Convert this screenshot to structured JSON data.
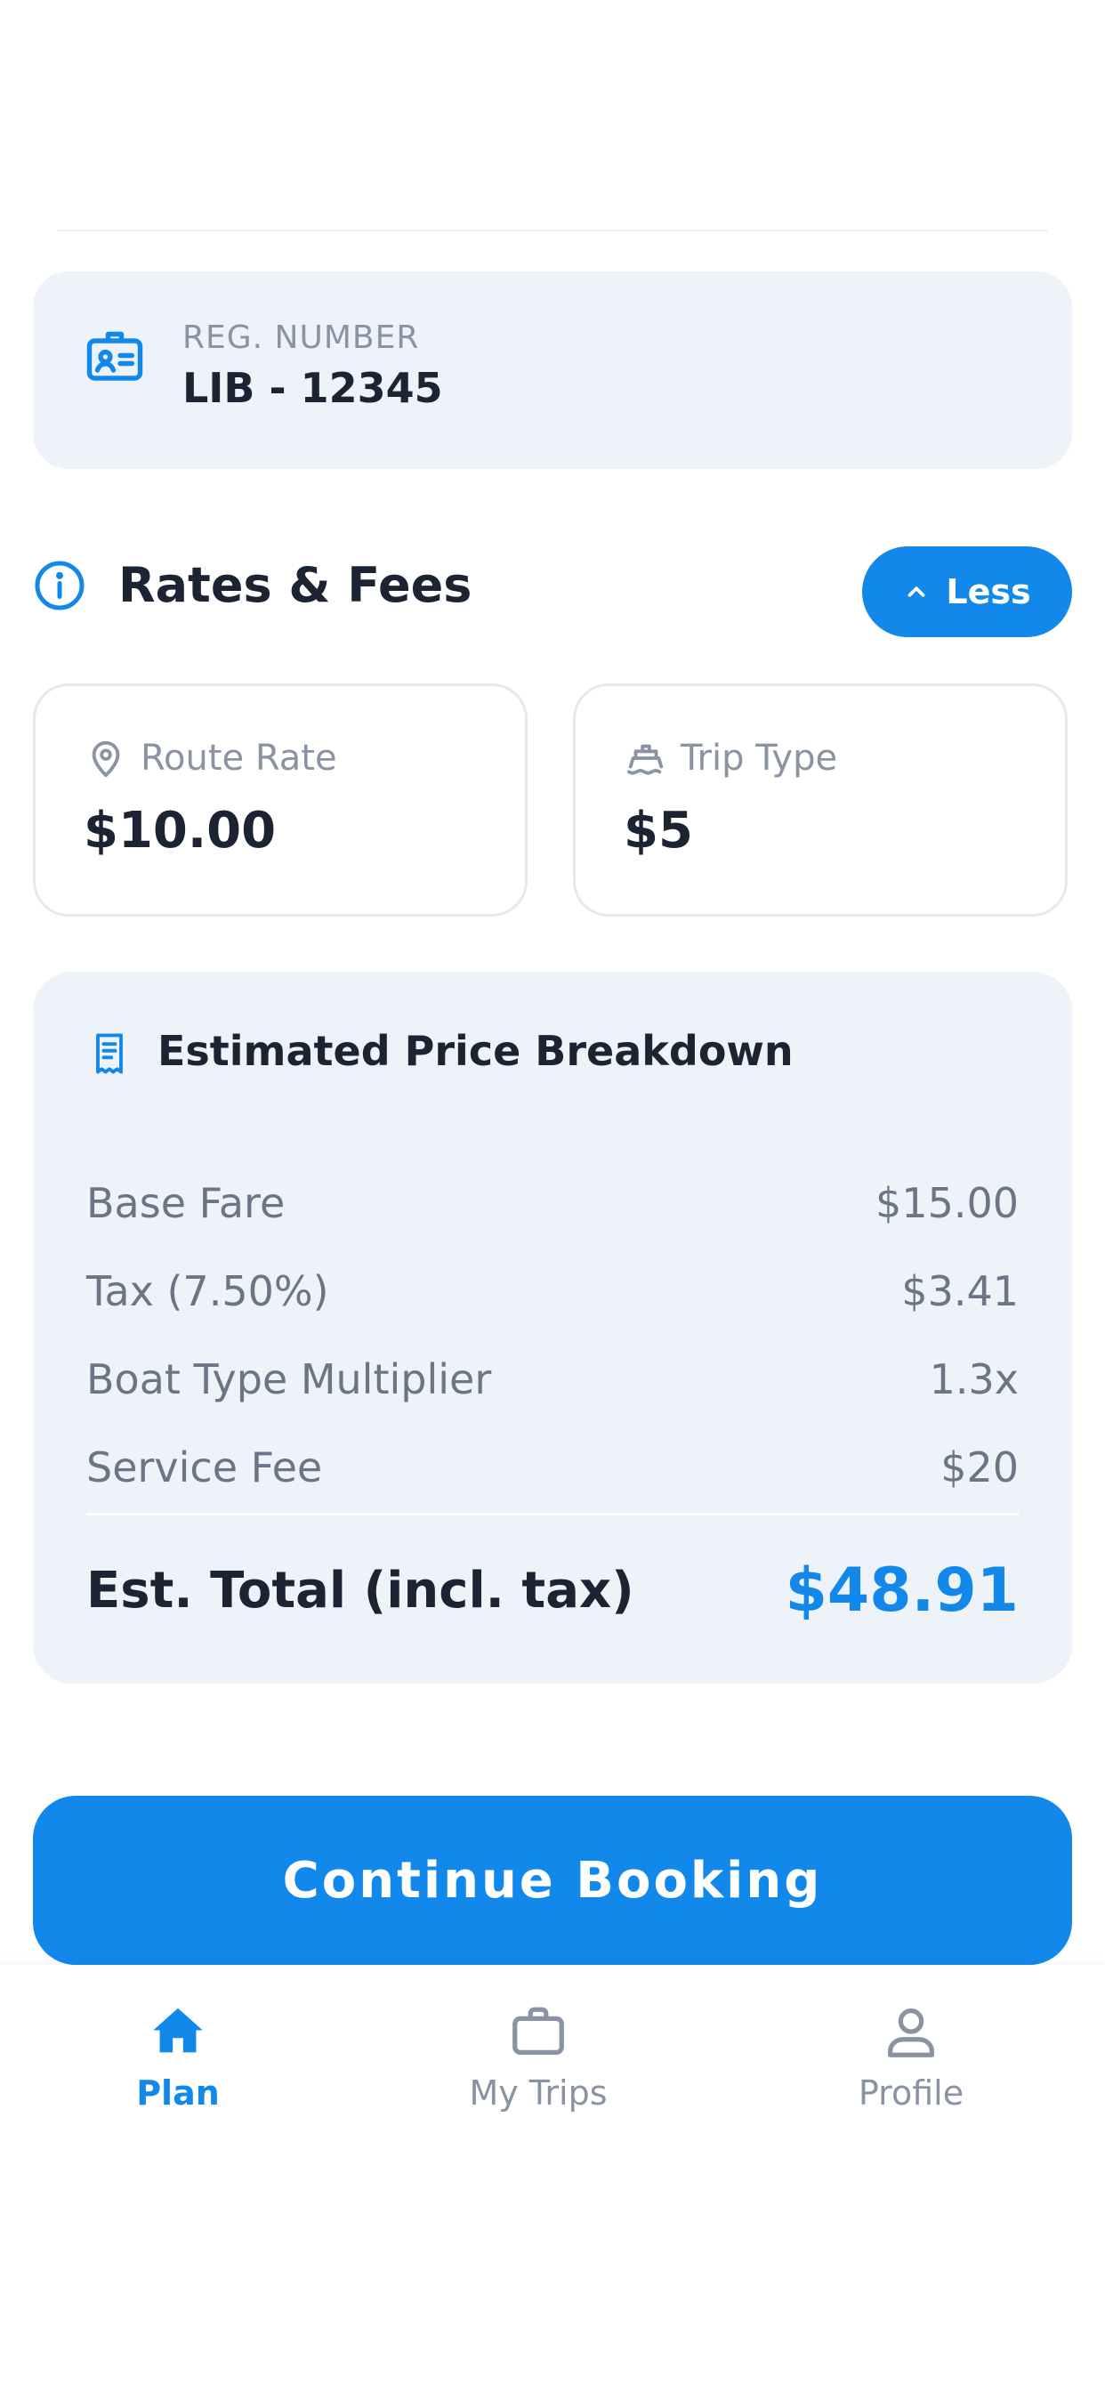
{
  "registration": {
    "label": "REG. NUMBER",
    "value": "LIB - 12345"
  },
  "rates_section": {
    "title": "Rates & Fees",
    "toggle_label": "Less"
  },
  "rate_cards": [
    {
      "icon": "map-pin-icon",
      "label": "Route Rate",
      "value": "$10.00"
    },
    {
      "icon": "ship-icon",
      "label": "Trip Type",
      "value": "$5"
    }
  ],
  "breakdown": {
    "title": "Estimated Price Breakdown",
    "rows": [
      {
        "label": "Base Fare",
        "value": "$15.00"
      },
      {
        "label": "Tax (7.50%)",
        "value": "$3.41"
      },
      {
        "label": "Boat Type Multiplier",
        "value": "1.3x"
      },
      {
        "label": "Service Fee",
        "value": "$20"
      }
    ],
    "total_label": "Est. Total (incl. tax)",
    "total_value": "$48.91"
  },
  "continue_button": "Continue Booking",
  "tabs": [
    {
      "icon": "home-icon",
      "label": "Plan",
      "active": true
    },
    {
      "icon": "briefcase-icon",
      "label": "My Trips",
      "active": false
    },
    {
      "icon": "person-icon",
      "label": "Profile",
      "active": false
    }
  ],
  "colors": {
    "accent": "#1289ea",
    "card_bg": "#eef3f9",
    "text_dark": "#1c2434",
    "text_muted": "#8a93a3"
  }
}
